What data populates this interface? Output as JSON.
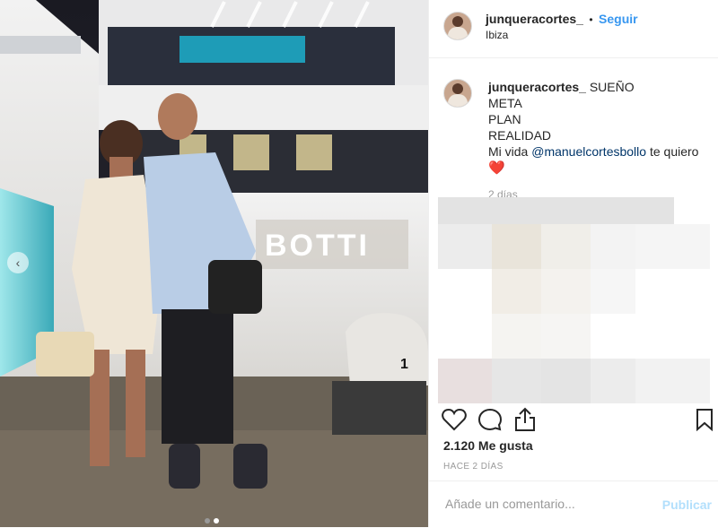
{
  "post": {
    "username": "junqueracortes_",
    "separator": "•",
    "follow_label": "Seguir",
    "location": "Ibiza",
    "boat_name": "BOTTI",
    "bollard_number": "1"
  },
  "caption": {
    "username": "junqueracortes_",
    "line1": "SUEÑO",
    "line2": "META",
    "line3": "PLAN",
    "line4": "REALIDAD",
    "line5_prefix": "Mi vida ",
    "mention": "@manuelcortesbollo",
    "line5_suffix": " te quiero",
    "emoji": "❤️",
    "time": "2 días"
  },
  "actions": {
    "like_icon": "heart-outline-icon",
    "comment_icon": "comment-icon",
    "share_icon": "share-icon",
    "save_icon": "bookmark-icon"
  },
  "likes_text": "2.120 Me gusta",
  "time_ago": "HACE 2 DÍAS",
  "comment": {
    "placeholder": "Añade un comentario...",
    "publish_label": "Publicar"
  },
  "carousel": {
    "prev_label": "‹",
    "active_dot_color": "#ffffff",
    "inactive_dot_color": "#999999"
  },
  "colors": {
    "link": "#3897f0",
    "mention": "#003569",
    "muted": "#999999"
  }
}
